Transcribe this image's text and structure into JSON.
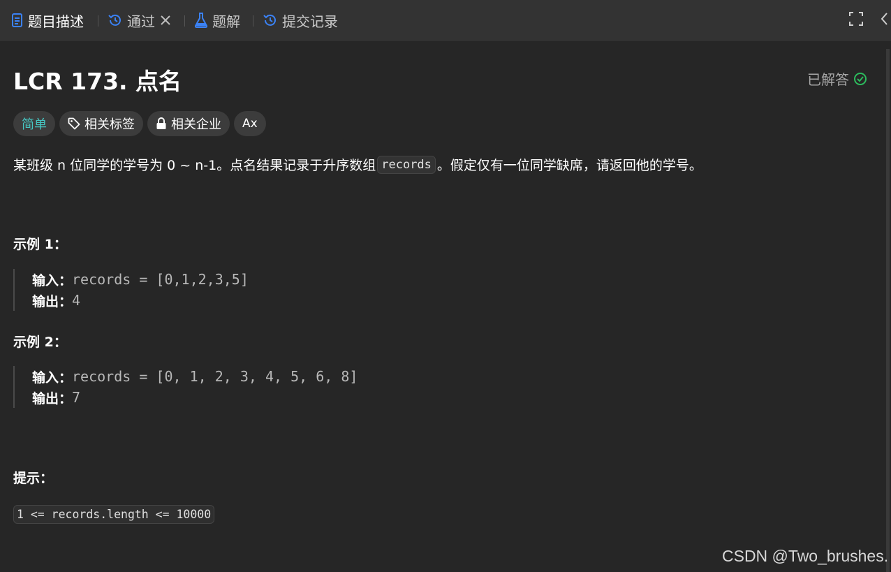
{
  "tabs": [
    {
      "label": "题目描述",
      "icon": "description-icon",
      "active": true
    },
    {
      "label": "通过",
      "icon": "history-icon",
      "closable": true
    },
    {
      "label": "题解",
      "icon": "flask-icon"
    },
    {
      "label": "提交记录",
      "icon": "history-icon"
    }
  ],
  "toolbar": {
    "fullscreen_icon": "fullscreen-icon",
    "collapse_icon": "chevron-left-icon"
  },
  "problem": {
    "title": "LCR 173. 点名",
    "status": "已解答",
    "status_color": "#2cbb5d",
    "tags": [
      {
        "label": "简单",
        "color": "#46c6c2"
      },
      {
        "label": "相关标签",
        "icon": "tag-icon"
      },
      {
        "label": "相关企业",
        "icon": "lock-icon"
      },
      {
        "label": "Ax",
        "icon": "translate-icon"
      }
    ],
    "description_before": "某班级 n 位同学的学号为 0 ~ n-1。点名结果记录于升序数组",
    "description_code": "records",
    "description_after": "。假定仅有一位同学缺席，请返回他的学号。"
  },
  "examples": [
    {
      "heading": "示例 1：",
      "input_label": "输入：",
      "input_value": "records = [0,1,2,3,5]",
      "output_label": "输出：",
      "output_value": "4"
    },
    {
      "heading": "示例 2：",
      "input_label": "输入：",
      "input_value": "records = [0, 1, 2, 3, 4, 5, 6, 8]",
      "output_label": "输出：",
      "output_value": "7"
    }
  ],
  "hints": {
    "heading": "提示：",
    "constraint": "1 <= records.length <= 10000"
  },
  "watermark": "CSDN @Two_brushes."
}
